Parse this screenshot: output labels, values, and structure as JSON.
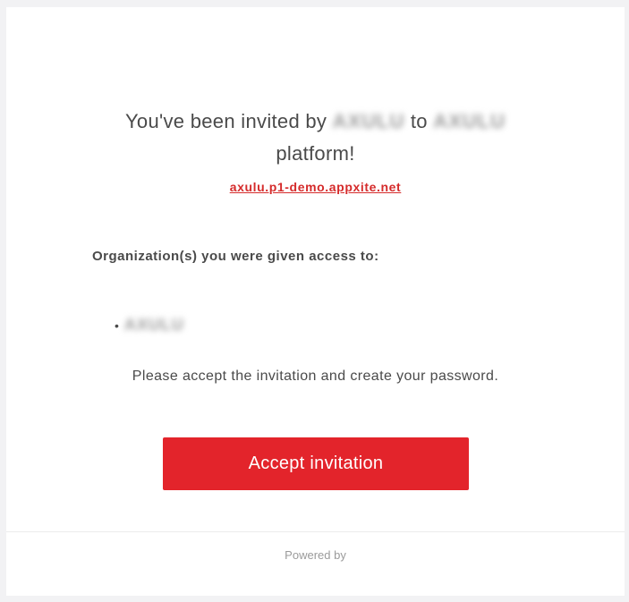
{
  "headline": {
    "prefix": "You've been invited by",
    "inviter": "AXULU",
    "connector": "to",
    "platform_name": "AXULU",
    "suffix": "platform!"
  },
  "platform_link": "axulu.p1-demo.appxite.net",
  "organizations": {
    "heading": "Organization(s) you were given access to:",
    "bullet": "•",
    "items": [
      "AXULU"
    ]
  },
  "instructions": "Please accept the invitation and create your password.",
  "accept_button_label": "Accept invitation",
  "footer": {
    "powered_by": "Powered by"
  },
  "colors": {
    "accent": "#e3242b",
    "link": "#d52b2b",
    "text": "#4a4a4a",
    "muted": "#9b9b9b",
    "background": "#f2f2f4"
  }
}
